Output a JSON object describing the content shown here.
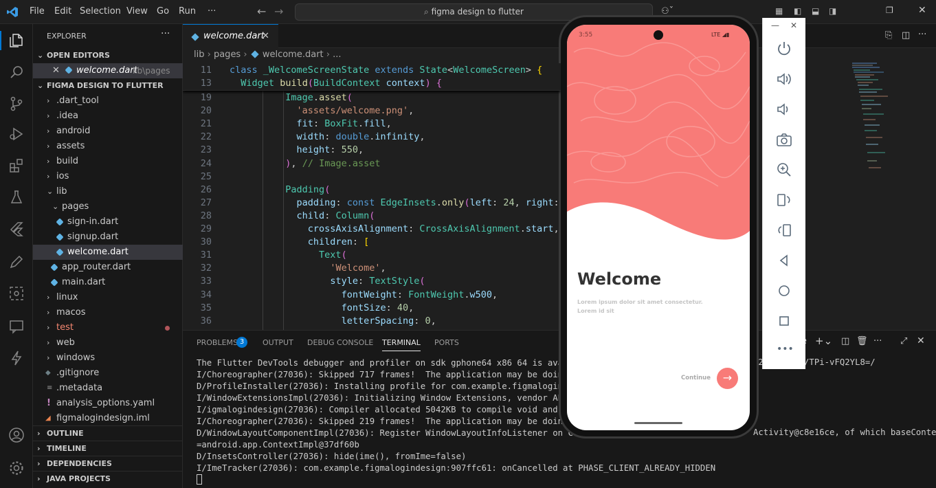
{
  "menu": [
    "File",
    "Edit",
    "Selection",
    "View",
    "Go",
    "Run",
    "···"
  ],
  "search": {
    "text": "figma design to flutter"
  },
  "explorer": {
    "title": "EXPLORER",
    "open_editors": "OPEN EDITORS",
    "open_file": "welcome.dart",
    "open_file_path": "lib\\pages",
    "project": "FIGMA DESIGN TO FLUTTER",
    "tree": [
      ".dart_tool",
      ".idea",
      "android",
      "assets",
      "build",
      "ios",
      "lib",
      "pages",
      "sign-in.dart",
      "signup.dart",
      "welcome.dart",
      "app_router.dart",
      "main.dart",
      "linux",
      "macos",
      "test",
      "web",
      "windows",
      ".gitignore",
      ".metadata",
      "analysis_options.yaml",
      "figmalogindesign.iml"
    ],
    "sections": [
      "OUTLINE",
      "TIMELINE",
      "DEPENDENCIES",
      "JAVA PROJECTS"
    ]
  },
  "editor": {
    "tab": "welcome.dart",
    "breadcrumb": [
      "lib",
      "pages",
      "welcome.dart",
      "..."
    ],
    "sticky": [
      {
        "n": "11",
        "t": "class _WelcomeScreenState extends State<WelcomeScreen> {"
      },
      {
        "n": "13",
        "t": "  Widget build(BuildContext context) {"
      }
    ],
    "lines": [
      {
        "n": "19",
        "t": "          Image.asset("
      },
      {
        "n": "20",
        "t": "            'assets/welcome.png',"
      },
      {
        "n": "21",
        "t": "            fit: BoxFit.fill,"
      },
      {
        "n": "22",
        "t": "            width: double.infinity,"
      },
      {
        "n": "23",
        "t": "            height: 550,"
      },
      {
        "n": "24",
        "t": "          ), // Image.asset"
      },
      {
        "n": "25",
        "t": ""
      },
      {
        "n": "26",
        "t": "          Padding("
      },
      {
        "n": "27",
        "t": "            padding: const EdgeInsets.only(left: 24, right: 24"
      },
      {
        "n": "28",
        "t": "            child: Column("
      },
      {
        "n": "29",
        "t": "              crossAxisAlignment: CrossAxisAlignment.start,"
      },
      {
        "n": "30",
        "t": "              children: ["
      },
      {
        "n": "31",
        "t": "                Text("
      },
      {
        "n": "32",
        "t": "                  'Welcome',"
      },
      {
        "n": "33",
        "t": "                  style: TextStyle("
      },
      {
        "n": "34",
        "t": "                    fontWeight: FontWeight.w500,"
      },
      {
        "n": "35",
        "t": "                    fontSize: 40,"
      },
      {
        "n": "36",
        "t": "                    letterSpacing: 0,"
      }
    ]
  },
  "panel": {
    "tabs": [
      "PROBLEMS",
      "OUTPUT",
      "DEBUG CONSOLE",
      "TERMINAL",
      "PORTS"
    ],
    "problems_count": "3",
    "terminal": [
      "The Flutter DevTools debugger and profiler on sdk gphone64 x86 64 is availab",
      "I/Choreographer(27036): Skipped 717 frames!  The application may be doing to",
      "D/ProfileInstaller(27036): Installing profile for com.example.figmalogindesi",
      "I/WindowExtensionsImpl(27036): Initializing Window Extensions, vendor API le",
      "I/igmalogindesign(27036): Compiler allocated 5042KB to compile void android",
      "I/Choreographer(27036): Skipped 219 frames!  The application may be doing to",
      "D/WindowLayoutComponentImpl(27036): Register WindowLayoutInfoListener on Conte",
      "=android.app.ContextImpl@37df60b",
      "D/InsetsController(27036): hide(ime(), fromIme=false)",
      "I/ImeTracker(27036): com.example.figmalogindesign:907ffc61: onCancelled at PHASE_CLIENT_ALREADY_HIDDEN"
    ],
    "term_tail1": "12   52107/TPi-vFQ2YL8=/",
    "term_tail2": "Activity@c8e16ce, of which baseContext"
  },
  "phone": {
    "time": "3:55",
    "status": "LTE ◢▮",
    "title": "Welcome",
    "body": "Lorem ipsum dolor sit amet consectetur. Lorem id sit",
    "cta": "Continue",
    "accent": "#f87b78"
  }
}
